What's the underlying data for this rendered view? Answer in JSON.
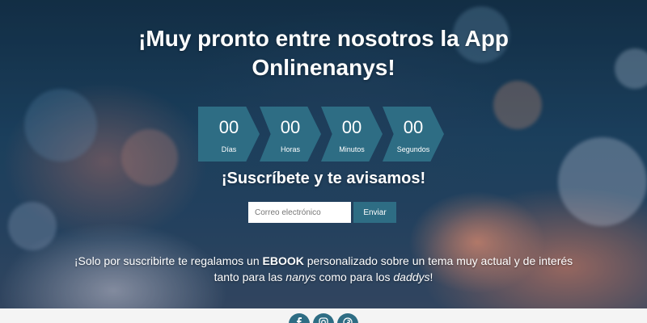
{
  "hero": {
    "title_line1": "¡Muy pronto entre nosotros la App",
    "title_line2": "Onlinenanys!",
    "subtitle": "¡Suscríbete y te avisamos!"
  },
  "countdown": [
    {
      "value": "00",
      "label": "Días"
    },
    {
      "value": "00",
      "label": "Horas"
    },
    {
      "value": "00",
      "label": "Minutos"
    },
    {
      "value": "00",
      "label": "Segundos"
    }
  ],
  "form": {
    "email_placeholder": "Correo electrónico",
    "email_value": "",
    "submit_label": "Enviar"
  },
  "promo": {
    "part1": "¡Solo por suscribirte te regalamos un ",
    "ebook": "EBOOK",
    "part2": " personalizado sobre un tema muy actual y de interés",
    "part3": "tanto para las ",
    "nanys": "nanys",
    "part4": " como para los ",
    "daddys": "daddys",
    "part5": "!"
  },
  "social": [
    {
      "icon": "facebook-icon"
    },
    {
      "icon": "instagram-icon"
    },
    {
      "icon": "pinterest-icon"
    }
  ],
  "colors": {
    "accent": "#2e6d84",
    "footer_bg": "#f4f4f4"
  }
}
